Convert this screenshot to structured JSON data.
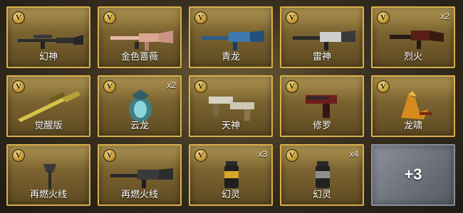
{
  "items": [
    {
      "name": "幻神",
      "count": "",
      "icon": "sniper-rifle-icon"
    },
    {
      "name": "金色蔷薇",
      "count": "",
      "icon": "rifle-icon"
    },
    {
      "name": "青龙",
      "count": "",
      "icon": "rifle-icon"
    },
    {
      "name": "雷神",
      "count": "",
      "icon": "rifle-icon"
    },
    {
      "name": "烈火",
      "count": "x2",
      "icon": "rifle-icon"
    },
    {
      "name": "觉醒版",
      "count": "",
      "icon": "sniper-rifle-icon"
    },
    {
      "name": "云龙",
      "count": "x2",
      "icon": "dragon-emblem-icon"
    },
    {
      "name": "天神",
      "count": "",
      "icon": "dual-pistols-icon"
    },
    {
      "name": "修罗",
      "count": "",
      "icon": "pistol-icon"
    },
    {
      "name": "龙啸",
      "count": "",
      "icon": "dragon-blade-icon"
    },
    {
      "name": "再燃火线",
      "count": "",
      "icon": "axe-icon"
    },
    {
      "name": "再燃火线",
      "count": "",
      "icon": "rifle-icon"
    },
    {
      "name": "幻灵",
      "count": "x3",
      "icon": "grenade-icon"
    },
    {
      "name": "幻灵",
      "count": "x4",
      "icon": "grenade-icon"
    }
  ],
  "badge_letter": "V",
  "more_label": "+3",
  "colors": {
    "tile_border": "#d9b04a",
    "tile_gold": "#7a6230",
    "more_gray": "#6f747d"
  }
}
